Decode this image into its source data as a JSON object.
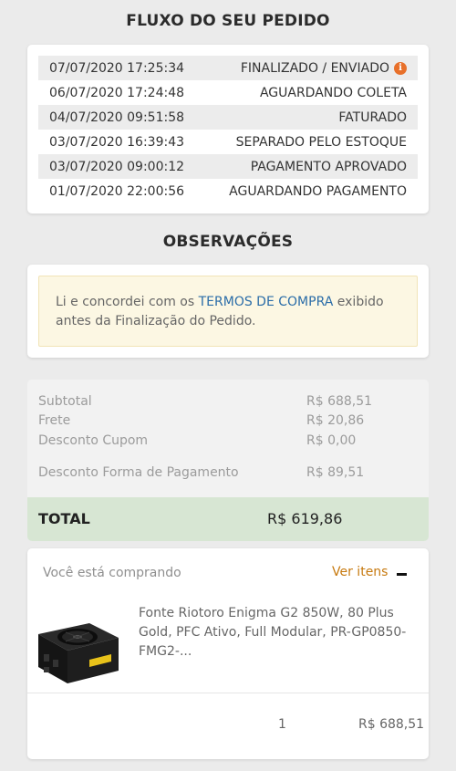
{
  "flow": {
    "title": "FLUXO DO SEU PEDIDO",
    "rows": [
      {
        "date": "07/07/2020 17:25:34",
        "status": "FINALIZADO / ENVIADO"
      },
      {
        "date": "06/07/2020 17:24:48",
        "status": "AGUARDANDO COLETA"
      },
      {
        "date": "04/07/2020 09:51:58",
        "status": "FATURADO"
      },
      {
        "date": "03/07/2020 16:39:43",
        "status": "SEPARADO PELO ESTOQUE"
      },
      {
        "date": "03/07/2020 09:00:12",
        "status": "PAGAMENTO APROVADO"
      },
      {
        "date": "01/07/2020 22:00:56",
        "status": "AGUARDANDO PAGAMENTO"
      }
    ],
    "info_icon": "info-icon",
    "info_glyph": "i"
  },
  "observations": {
    "title": "OBSERVAÇÕES",
    "text_before": "Li e concordei com os ",
    "link_text": "TERMOS DE COMPRA",
    "text_after": " exibido antes da Finalização do Pedido."
  },
  "summary": {
    "subtotal_label": "Subtotal",
    "subtotal_value": "R$ 688,51",
    "frete_label": "Frete",
    "frete_value": "R$ 20,86",
    "cupom_label": "Desconto Cupom",
    "cupom_value": "R$ 0,00",
    "pagamento_label": "Desconto Forma de Pagamento",
    "pagamento_value": "R$ 89,51",
    "total_label": "TOTAL",
    "total_value": "R$ 619,86"
  },
  "items": {
    "buying_label": "Você está comprando",
    "ver_itens": "Ver itens",
    "product_name": "Fonte Riotoro Enigma G2 850W, 80 Plus Gold, PFC Ativo, Full Modular, PR-GP0850-FMG2-...",
    "quantity": "1",
    "price": "R$ 688,51"
  },
  "colors": {
    "accent_orange": "#e8702a",
    "link_blue": "#2b6da8",
    "ver_itens": "#c77a10",
    "total_green": "#d7e6d3",
    "note_bg": "#fcf7e3"
  }
}
